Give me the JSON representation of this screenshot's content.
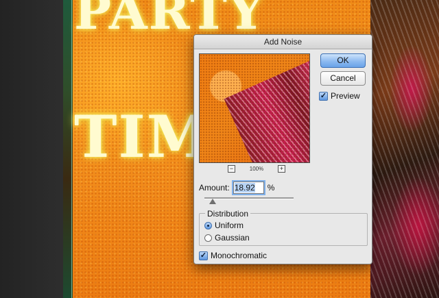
{
  "background": {
    "words": [
      "PARTY",
      "TIM"
    ]
  },
  "dialog": {
    "title": "Add Noise",
    "zoom": {
      "minus": "−",
      "value": "100%",
      "plus": "+"
    },
    "buttons": {
      "ok": "OK",
      "cancel": "Cancel"
    },
    "preview": {
      "label": "Preview",
      "checked": true
    },
    "amount": {
      "label": "Amount:",
      "value": "18.92",
      "unit": "%",
      "slider_fraction": 0.09
    },
    "distribution": {
      "legend": "Distribution",
      "options": [
        {
          "label": "Uniform",
          "selected": true
        },
        {
          "label": "Gaussian",
          "selected": false
        }
      ]
    },
    "monochromatic": {
      "label": "Monochromatic",
      "checked": true
    }
  },
  "colors": {
    "accent": "#6aa2e8",
    "canvas_orange": "#f08a17"
  }
}
